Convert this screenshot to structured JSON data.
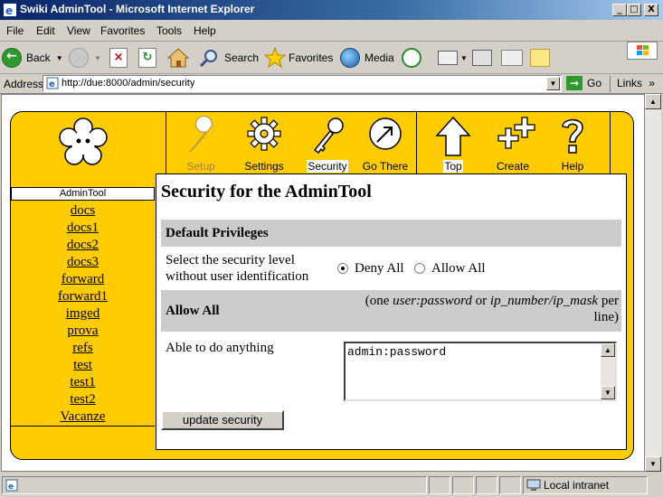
{
  "window": {
    "title": "Swiki AdminTool - Microsoft Internet Explorer",
    "minimize": "_",
    "maximize": "□",
    "close": "X"
  },
  "menu": [
    "File",
    "Edit",
    "View",
    "Favorites",
    "Tools",
    "Help"
  ],
  "toolbar": {
    "back": "Back",
    "search": "Search",
    "favorites": "Favorites",
    "media": "Media"
  },
  "address": {
    "label": "Address",
    "url": "http://due:8000/admin/security",
    "go": "Go",
    "links": "Links"
  },
  "page": {
    "nav": [
      {
        "label": "Setup",
        "state": "disabled"
      },
      {
        "label": "Settings",
        "state": "normal"
      },
      {
        "label": "Security",
        "state": "selected"
      },
      {
        "label": "Go There",
        "state": "normal"
      }
    ],
    "nav2": [
      {
        "label": "Top",
        "state": "selected"
      },
      {
        "label": "Create",
        "state": "normal"
      },
      {
        "label": "Help",
        "state": "normal"
      }
    ],
    "sidebar": {
      "title": "AdminTool",
      "links": [
        "docs",
        "docs1",
        "docs2",
        "docs3",
        "forward",
        "forward1",
        "imged",
        "prova",
        "refs",
        "test",
        "test1",
        "test2",
        "Vacanze"
      ]
    },
    "heading": "Security for the AdminTool",
    "default_privileges": {
      "title": "Default Privileges",
      "description": "Select the security level without user identification",
      "options": [
        {
          "label": "Deny All",
          "selected": true
        },
        {
          "label": "Allow All",
          "selected": false
        }
      ]
    },
    "allow_all": {
      "title": "Allow All",
      "hint_prefix": "(one ",
      "hint_em1": "user:password",
      "hint_mid": " or ",
      "hint_em2": "ip_number/ip_mask",
      "hint_suffix": " per line)",
      "description": "Able to do anything",
      "value": "admin:password"
    },
    "submit": "update security"
  },
  "status": {
    "zone": "Local intranet"
  },
  "colors": {
    "page_bg": "#ffcc00",
    "band": "#cccccc",
    "titlebar": "#0a246a"
  }
}
